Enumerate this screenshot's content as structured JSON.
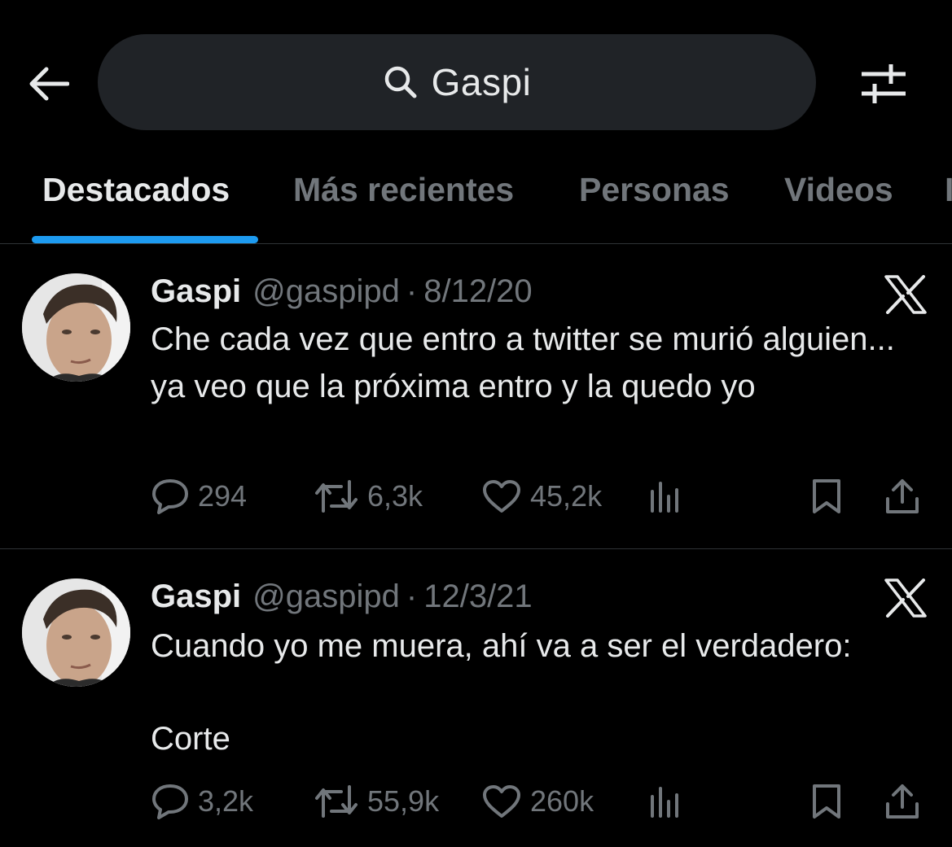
{
  "search": {
    "query": "Gaspi"
  },
  "tabs": [
    {
      "label": "Destacados",
      "active": true
    },
    {
      "label": "Más recientes",
      "active": false
    },
    {
      "label": "Personas",
      "active": false
    },
    {
      "label": "Videos",
      "active": false
    }
  ],
  "tweets": [
    {
      "display_name": "Gaspi",
      "handle": "@gaspipd",
      "separator": "·",
      "date": "8/12/20",
      "text": "Che cada vez que entro a twitter se murió alguien... ya veo que la próxima entro y la quedo yo",
      "replies": "294",
      "retweets": "6,3k",
      "likes": "45,2k"
    },
    {
      "display_name": "Gaspi",
      "handle": "@gaspipd",
      "separator": "·",
      "date": "12/3/21",
      "text_line1": "Cuando yo me muera, ahí va a ser el verdadero:",
      "text_line2": "Corte",
      "replies": "3,2k",
      "retweets": "55,9k",
      "likes": "260k"
    }
  ],
  "icons": {
    "back": "arrow-left-icon",
    "search": "search-icon",
    "filter": "filter-sliders-icon",
    "platform": "x-logo-icon",
    "reply": "reply-bubble-icon",
    "retweet": "retweet-icon",
    "like": "heart-icon",
    "views": "views-bar-icon",
    "bookmark": "bookmark-icon",
    "share": "share-icon"
  },
  "colors": {
    "background": "#000000",
    "text_primary": "#e7e9ea",
    "text_secondary": "#71767b",
    "accent": "#1d9bf0",
    "search_bg": "#202327",
    "divider": "#2f3336"
  }
}
